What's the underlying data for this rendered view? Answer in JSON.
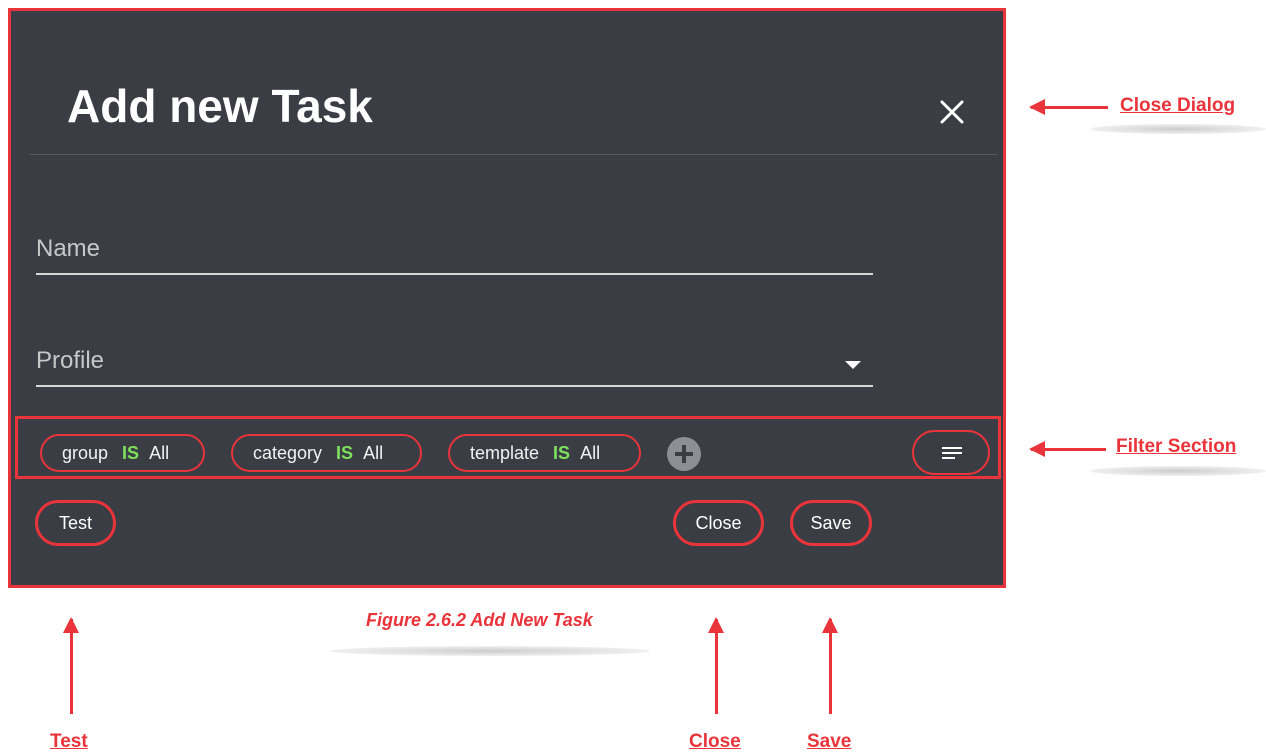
{
  "dialog": {
    "title": "Add new Task",
    "fields": {
      "name_label": "Name",
      "profile_label": "Profile"
    },
    "filters": [
      {
        "field": "group",
        "operator": "IS",
        "value": "All"
      },
      {
        "field": "category",
        "operator": "IS",
        "value": "All"
      },
      {
        "field": "template",
        "operator": "IS",
        "value": "All"
      }
    ],
    "buttons": {
      "test": "Test",
      "close": "Close",
      "save": "Save"
    }
  },
  "caption": "Figure 2.6.2 Add New Task",
  "callouts": {
    "close_dialog": "Close Dialog",
    "filter_section": "Filter Section",
    "test": "Test",
    "close": "Close",
    "save": "Save"
  },
  "colors": {
    "dialog_bg": "#3a3d44",
    "annotation": "#e8343a",
    "operator": "#7ee05c"
  },
  "icons": [
    "close-icon",
    "dropdown-arrow-icon",
    "add-filter-icon",
    "filter-menu-icon",
    "arrow-icon"
  ]
}
